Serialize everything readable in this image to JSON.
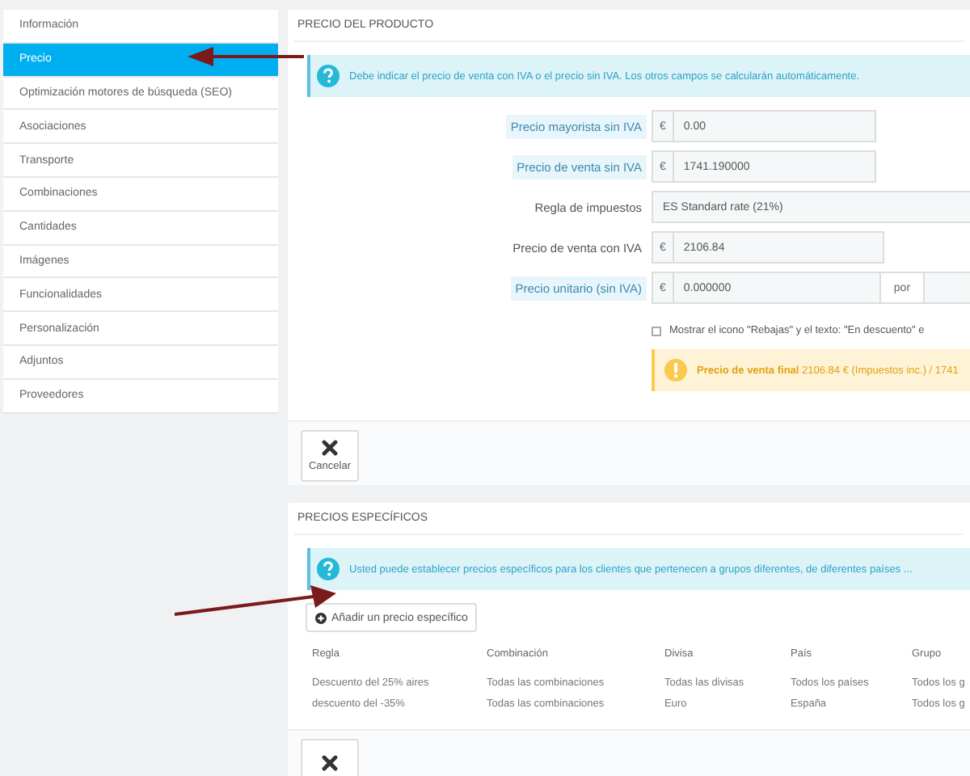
{
  "sidebar": {
    "items": [
      {
        "label": "Información",
        "selected": false
      },
      {
        "label": "Precio",
        "selected": true
      },
      {
        "label": "Optimización motores de búsqueda (SEO)",
        "selected": false
      },
      {
        "label": "Asociaciones",
        "selected": false
      },
      {
        "label": "Transporte",
        "selected": false
      },
      {
        "label": "Combinaciones",
        "selected": false
      },
      {
        "label": "Cantidades",
        "selected": false
      },
      {
        "label": "Imágenes",
        "selected": false
      },
      {
        "label": "Funcionalidades",
        "selected": false
      },
      {
        "label": "Personalización",
        "selected": false
      },
      {
        "label": "Adjuntos",
        "selected": false
      },
      {
        "label": "Proveedores",
        "selected": false
      }
    ]
  },
  "price_panel": {
    "title": "PRECIO DEL PRODUCTO",
    "info": "Debe indicar el precio de venta con IVA o el precio sin IVA. Los otros campos se calcularán automáticamente.",
    "fields": [
      {
        "kind": "money",
        "label": "Precio mayorista sin IVA",
        "hint": true,
        "prefix": "€",
        "value": "0.00"
      },
      {
        "kind": "money",
        "label": "Precio de venta sin IVA",
        "hint": true,
        "prefix": "€",
        "value": "1741.190000"
      },
      {
        "kind": "select",
        "label": "Regla de impuestos",
        "hint": false,
        "value": "ES Standard rate (21%)"
      },
      {
        "kind": "money",
        "label": "Precio de venta con IVA",
        "hint": false,
        "prefix": "€",
        "value": "2106.84"
      },
      {
        "kind": "unit",
        "label": "Precio unitario (sin IVA)",
        "hint": true,
        "prefix": "€",
        "value": "0.000000",
        "suffix": "por"
      }
    ],
    "on_sale": {
      "label": "Mostrar el icono \"Rebajas\" y el texto: \"En descuento\" e",
      "checked": false
    },
    "warning": "**Precio de venta final** 2106.84 € (Impuestos inc.) / 1741",
    "cancel": "Cancelar"
  },
  "specific_panel": {
    "title": "PRECIOS ESPECÍFICOS",
    "info": "Usted puede establecer precios específicos para los clientes que pertenecen a grupos diferentes, de diferentes países ...",
    "add_button": "Añadir un precio específico",
    "table": {
      "columns": [
        "Regla",
        "Combinación",
        "Divisa",
        "País",
        "Grupo"
      ],
      "rows": [
        [
          "Descuento del 25% aires",
          "Todas las combinaciones",
          "Todas las divisas",
          "Todos los países",
          "Todos los g"
        ],
        [
          "descuento del -35%",
          "Todas las combinaciones",
          "Euro",
          "España",
          "Todos los g"
        ]
      ]
    }
  }
}
